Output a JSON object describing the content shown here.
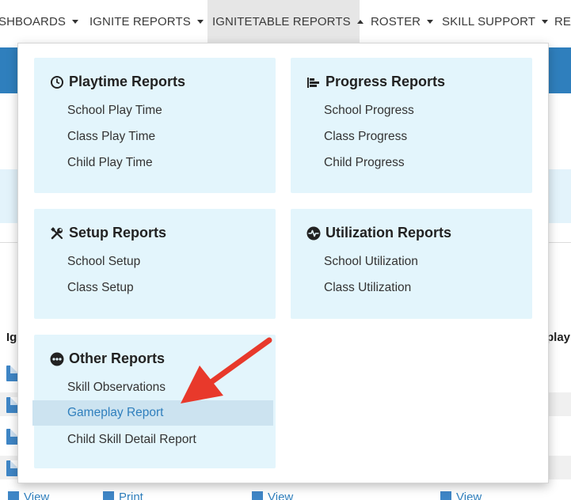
{
  "nav": {
    "items": [
      {
        "label": "SHBOARDS",
        "caret": "down"
      },
      {
        "label": "IGNITE REPORTS",
        "caret": "down"
      },
      {
        "label": "IGNITETABLE REPORTS",
        "caret": "up"
      },
      {
        "label": "ROSTER",
        "caret": "down"
      },
      {
        "label": "SKILL SUPPORT",
        "caret": "down"
      },
      {
        "label": "RE",
        "caret": "none"
      }
    ]
  },
  "background": {
    "col_head_left": "Ig",
    "col_head_right": "play",
    "links": [
      "View",
      "Print",
      "View",
      "View"
    ]
  },
  "menu": {
    "playtime": {
      "title": "Playtime Reports",
      "icon": "clock-icon",
      "links": [
        "School Play Time",
        "Class Play Time",
        "Child Play Time"
      ]
    },
    "progress": {
      "title": "Progress Reports",
      "icon": "bar-chart-icon",
      "links": [
        "School Progress",
        "Class Progress",
        "Child Progress"
      ]
    },
    "setup": {
      "title": "Setup Reports",
      "icon": "wrench-screwdriver-icon",
      "links": [
        "School Setup",
        "Class Setup"
      ]
    },
    "utilization": {
      "title": "Utilization Reports",
      "icon": "heartbeat-icon",
      "links": [
        "School Utilization",
        "Class Utilization"
      ]
    },
    "other": {
      "title": "Other Reports",
      "icon": "ellipsis-circle-icon",
      "links": [
        "Skill Observations",
        "Gameplay Report",
        "Child Skill Detail Report"
      ],
      "highlighted": "Gameplay Report"
    }
  },
  "colors": {
    "card_bg": "#e3f5fc",
    "highlight_bg": "#cce3f0",
    "link_blue": "#2f7fbd",
    "arrow_red": "#e8392b"
  }
}
